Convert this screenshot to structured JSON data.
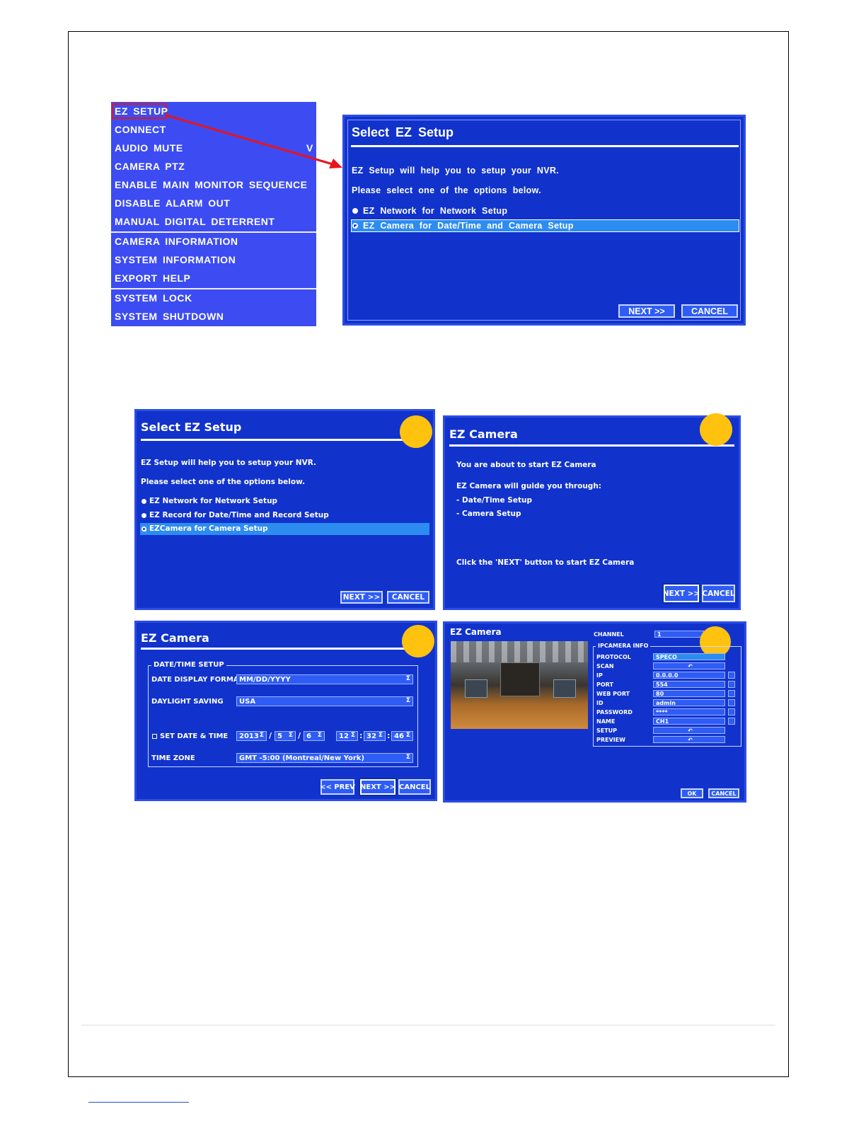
{
  "menu": {
    "items": [
      "EZ SETUP",
      "CONNECT",
      "AUDIO MUTE",
      "CAMERA PTZ",
      "ENABLE MAIN MONITOR SEQUENCE",
      "DISABLE ALARM OUT",
      "MANUAL DIGITAL DETERRENT",
      "CAMERA INFORMATION",
      "SYSTEM INFORMATION",
      "EXPORT HELP",
      "SYSTEM LOCK",
      "SYSTEM SHUTDOWN"
    ],
    "audio_mute_check": "V"
  },
  "dialog1": {
    "title": "Select EZ Setup",
    "line1": "EZ Setup will help you to setup your NVR.",
    "line2": "Please select one of the options below.",
    "option1": "EZ Network for Network Setup",
    "option2": "EZ Camera for Date/Time and Camera Setup",
    "next": "NEXT >>",
    "cancel": "CANCEL"
  },
  "dialog2": {
    "title": "Select EZ Setup",
    "line1": "EZ Setup will help you to setup your NVR.",
    "line2": "Please select one of the options below.",
    "option1": "EZ Network for Network Setup",
    "option2": "EZ Record for Date/Time and Record Setup",
    "option3": "EZCamera for Camera Setup",
    "next": "NEXT >>",
    "cancel": "CANCEL"
  },
  "dialog3": {
    "title": "EZ Camera",
    "line1": "You are about to start EZ Camera",
    "line2": "EZ Camera will guide you through:",
    "bullet1": "- Date/Time Setup",
    "bullet2": "- Camera Setup",
    "line3": "Click the 'NEXT' button to start EZ Camera",
    "next": "NEXT >>",
    "cancel": "CANCEL"
  },
  "dialog4": {
    "title": "EZ Camera",
    "legend": "DATE/TIME SETUP",
    "date_format_label": "DATE DISPLAY FORMAT",
    "date_format_value": "MM/DD/YYYY",
    "dst_label": "DAYLIGHT SAVING",
    "dst_value": "USA",
    "set_date_label": "SET DATE & TIME",
    "year": "2013",
    "month": "5",
    "day": "6",
    "hour": "12",
    "minute": "32",
    "second": "46",
    "slash": "/",
    "colon": ":",
    "timezone_label": "TIME ZONE",
    "timezone_value": "GMT -5:00 (Montreal/New York)",
    "prev": "<< PREV",
    "next": "NEXT >>",
    "cancel": "CANCEL"
  },
  "dialog5": {
    "title": "EZ Camera",
    "channel_label": "CHANNEL",
    "channel_value": "1",
    "legend": "IPCAMERA INFO",
    "rows": [
      {
        "label": "PROTOCOL",
        "value": "SPECO"
      },
      {
        "label": "SCAN",
        "value": ""
      },
      {
        "label": "IP",
        "value": "0.0.0.0"
      },
      {
        "label": "PORT",
        "value": "554"
      },
      {
        "label": "WEB PORT",
        "value": "80"
      },
      {
        "label": "ID",
        "value": "admin"
      },
      {
        "label": "PASSWORD",
        "value": "****"
      },
      {
        "label": "NAME",
        "value": "CH1"
      },
      {
        "label": "SETUP",
        "value": ""
      },
      {
        "label": "PREVIEW",
        "value": ""
      }
    ],
    "ok": "OK",
    "cancel": "CANCEL"
  },
  "colors": {
    "dialog_bg": "#1133cc",
    "menu_bg": "#3c4cf2",
    "highlight": "#2d8cf0",
    "marker": "#ffc20e",
    "arrow": "#e8141c"
  }
}
